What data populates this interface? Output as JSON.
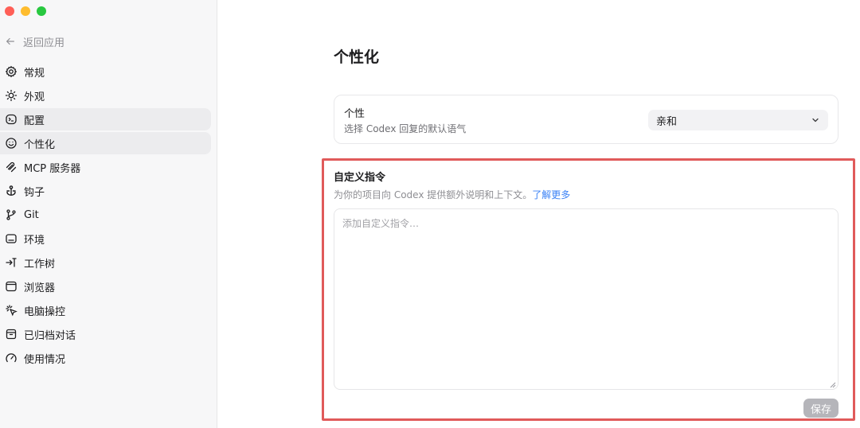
{
  "window": {
    "traffic_lights": {
      "close": "#ff5f57",
      "minimize": "#febc2e",
      "zoom": "#28c840"
    }
  },
  "sidebar": {
    "back_label": "返回应用",
    "items": [
      {
        "label": "常规",
        "icon": "gear-icon",
        "active": false
      },
      {
        "label": "外观",
        "icon": "sun-icon",
        "active": false
      },
      {
        "label": "配置",
        "icon": "config-icon",
        "active": true
      },
      {
        "label": "个性化",
        "icon": "personalize-icon",
        "active": true
      },
      {
        "label": "MCP 服务器",
        "icon": "mcp-icon",
        "active": false
      },
      {
        "label": "钩子",
        "icon": "hook-icon",
        "active": false
      },
      {
        "label": "Git",
        "icon": "git-branch-icon",
        "active": false
      },
      {
        "label": "环境",
        "icon": "environment-icon",
        "active": false
      },
      {
        "label": "工作树",
        "icon": "worktree-icon",
        "active": false
      },
      {
        "label": "浏览器",
        "icon": "browser-icon",
        "active": false
      },
      {
        "label": "电脑操控",
        "icon": "computer-control-icon",
        "active": false
      },
      {
        "label": "已归档对话",
        "icon": "archive-icon",
        "active": false
      },
      {
        "label": "使用情况",
        "icon": "gauge-icon",
        "active": false
      }
    ]
  },
  "main": {
    "title": "个性化",
    "personality": {
      "label": "个性",
      "description": "选择 Codex 回复的默认语气",
      "selected": "亲和"
    },
    "custom_instructions": {
      "title": "自定义指令",
      "description": "为你的项目向 Codex 提供额外说明和上下文。",
      "link_text": "了解更多",
      "placeholder": "添加自定义指令…",
      "value": "",
      "save_label": "保存"
    }
  },
  "colors": {
    "highlight_border": "#e05a5a",
    "link": "#3b82f6",
    "save_button_disabled": "#b5b5ba"
  }
}
